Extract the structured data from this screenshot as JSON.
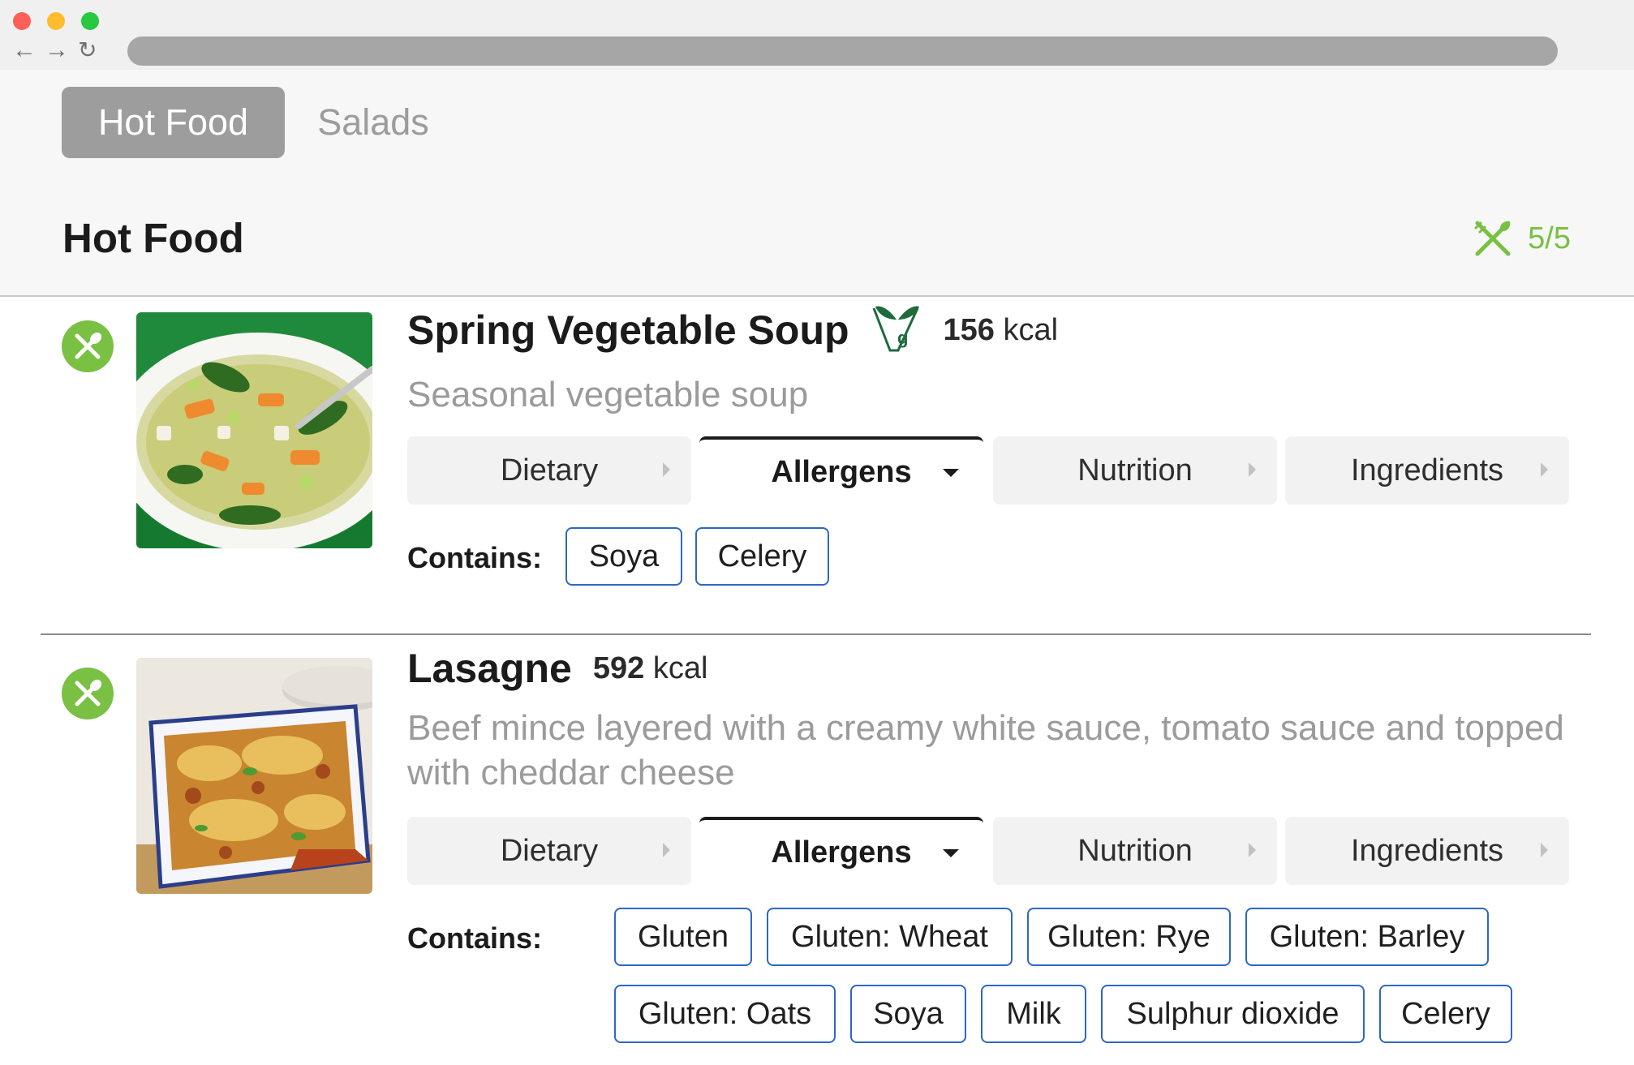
{
  "browser": {
    "back_icon": "arrow-left",
    "forward_icon": "arrow-right",
    "reload_icon": "reload"
  },
  "categories": [
    {
      "label": "Hot Food",
      "active": true
    },
    {
      "label": "Salads",
      "active": false
    }
  ],
  "section": {
    "title": "Hot Food",
    "count": "5/5",
    "count_icon": "cutlery-icon"
  },
  "items": [
    {
      "name": "Spring Vegetable Soup",
      "badge_icon": "vegan-icon",
      "kcal_value": "156",
      "kcal_unit": "kcal",
      "description": "Seasonal vegetable soup",
      "tabs": [
        "Dietary",
        "Allergens",
        "Nutrition",
        "Ingredients"
      ],
      "selected_tab": "Allergens",
      "contains_label": "Contains:",
      "allergens": [
        "Soya",
        "Celery"
      ]
    },
    {
      "name": "Lasagne",
      "kcal_value": "592",
      "kcal_unit": "kcal",
      "description": "Beef mince layered with a creamy white sauce, tomato sauce and topped with cheddar cheese",
      "tabs": [
        "Dietary",
        "Allergens",
        "Nutrition",
        "Ingredients"
      ],
      "selected_tab": "Allergens",
      "contains_label": "Contains:",
      "allergens": [
        "Gluten",
        "Gluten: Wheat",
        "Gluten: Rye",
        "Gluten: Barley",
        "Gluten: Oats",
        "Soya",
        "Milk",
        "Sulphur dioxide",
        "Celery"
      ]
    }
  ],
  "colors": {
    "accent_green": "#79c043",
    "chip_border": "#2d67c4",
    "vegan_green": "#1e6b3c"
  }
}
